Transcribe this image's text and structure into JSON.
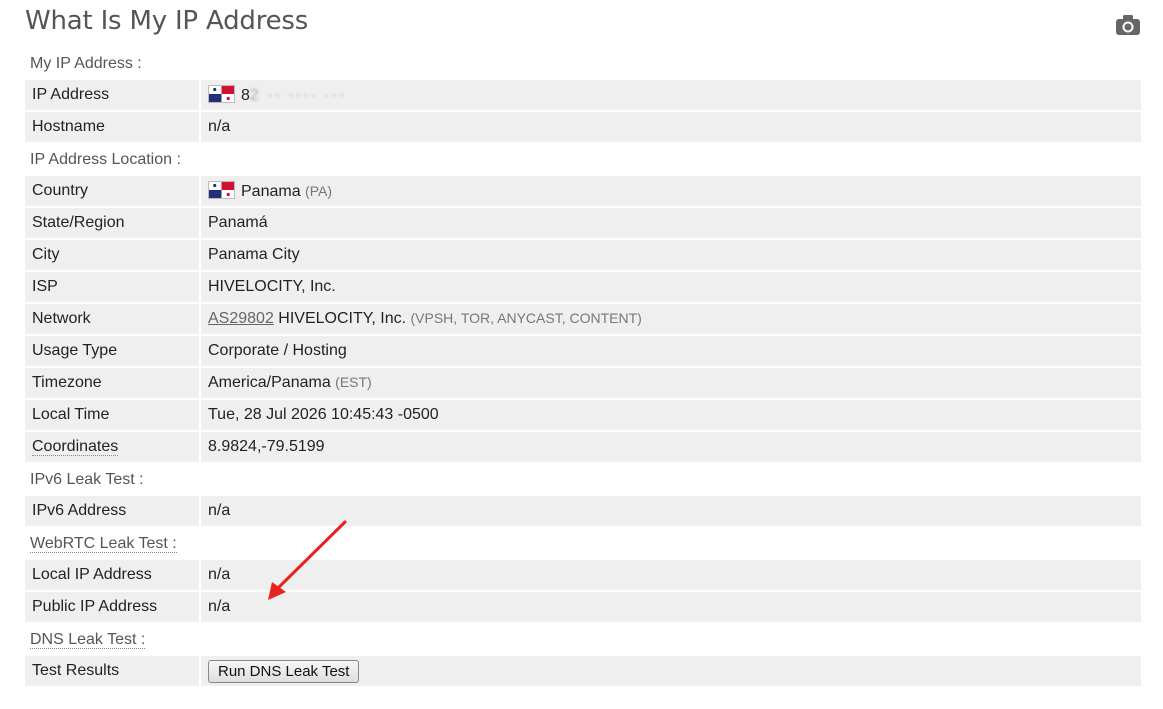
{
  "header": {
    "title": "What Is My IP Address"
  },
  "sections": {
    "my_ip": {
      "title": "My IP Address :",
      "rows": [
        {
          "label": "IP Address",
          "value": "8"
        },
        {
          "label": "Hostname",
          "value": "n/a"
        }
      ]
    },
    "location": {
      "title": "IP Address Location :",
      "country": {
        "label": "Country",
        "value": "Panama",
        "code": "(PA)"
      },
      "state": {
        "label": "State/Region",
        "value": "Panamá"
      },
      "city": {
        "label": "City",
        "value": "Panama City"
      },
      "isp": {
        "label": "ISP",
        "value": "HIVELOCITY, Inc."
      },
      "network": {
        "label": "Network",
        "asn": "AS29802",
        "name": "HIVELOCITY, Inc.",
        "tags": "(VPSH, TOR, ANYCAST, CONTENT)"
      },
      "usage": {
        "label": "Usage Type",
        "value": "Corporate / Hosting"
      },
      "timezone": {
        "label": "Timezone",
        "value": "America/Panama",
        "abbr": "(EST)"
      },
      "local_time": {
        "label": "Local Time",
        "value": "Tue, 28 Jul 2026 10:45:43 -0500"
      },
      "coordinates": {
        "label": "Coordinates",
        "value": "8.9824,-79.5199"
      }
    },
    "ipv6": {
      "title": "IPv6 Leak Test :",
      "row": {
        "label": "IPv6 Address",
        "value": "n/a"
      }
    },
    "webrtc": {
      "title": "WebRTC Leak Test :",
      "local": {
        "label": "Local IP Address",
        "value": "n/a"
      },
      "public": {
        "label": "Public IP Address",
        "value": "n/a"
      }
    },
    "dns": {
      "title": "DNS Leak Test :",
      "row": {
        "label": "Test Results",
        "button": "Run DNS Leak Test"
      }
    }
  },
  "colors": {
    "row_bg": "#efefef",
    "arrow": "#e8231f",
    "flag_blue": "#24307a",
    "flag_red": "#d21034"
  },
  "icons": {
    "camera": "camera-icon",
    "flag": "panama-flag-icon",
    "annotation": "red-arrow"
  }
}
